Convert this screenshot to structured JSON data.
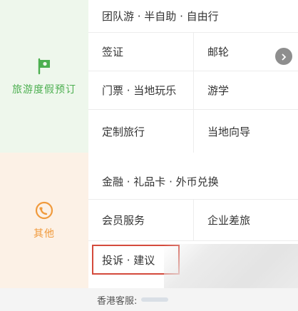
{
  "sections": [
    {
      "title": "旅游度假预订",
      "icon": "travel-flag-icon",
      "accent": "#4caf50",
      "header_row": "团队游 · 半自助 · 自由行",
      "items": [
        {
          "left": "签证",
          "right": "邮轮"
        },
        {
          "left": "门票 · 当地玩乐",
          "right": "游学"
        },
        {
          "left": "定制旅行",
          "right": "当地向导"
        }
      ]
    },
    {
      "title": "其他",
      "icon": "customer-service-icon",
      "accent": "#f09a3c",
      "header_row": "金融 · 礼品卡 · 外币兑换",
      "items": [
        {
          "left": "会员服务",
          "right": "企业差旅"
        },
        {
          "left": "投诉 · 建议",
          "right": ""
        }
      ]
    }
  ],
  "footer": {
    "label": "香港客服:"
  },
  "colors": {
    "highlight": "#d44a3c",
    "travel_bg": "#eef7ec",
    "other_bg": "#fcf1e6"
  }
}
